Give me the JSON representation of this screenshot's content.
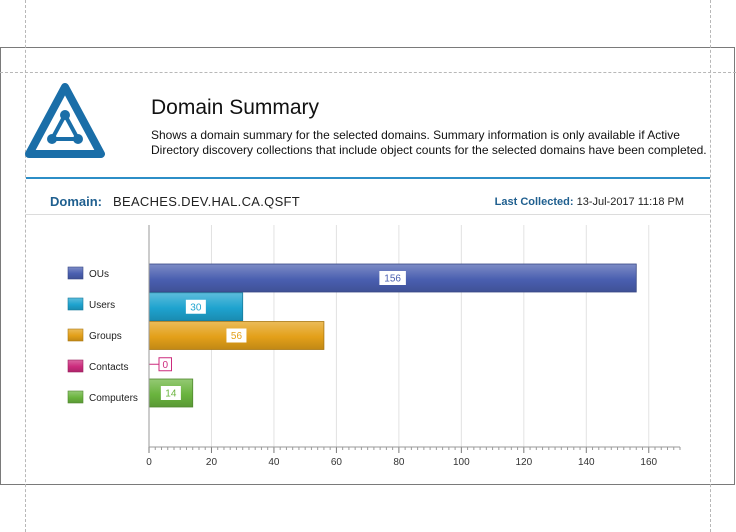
{
  "header": {
    "title": "Domain Summary",
    "description": "Shows a domain summary for the selected domains. Summary information is only available if Active Directory discovery collections that include object counts for the selected domains have been completed."
  },
  "domain": {
    "label": "Domain:",
    "value": "BEACHES.DEV.HAL.CA.QSFT",
    "last_collected_label": "Last Collected:",
    "last_collected_value": "13-Jul-2017 11:18 PM"
  },
  "colors": {
    "accent": "#2c8ec7",
    "logo": "#1a6ea8"
  },
  "chart_data": {
    "type": "bar",
    "orientation": "horizontal",
    "categories": [
      "OUs",
      "Users",
      "Groups",
      "Contacts",
      "Computers"
    ],
    "values": [
      156,
      30,
      56,
      0,
      14
    ],
    "colors": [
      "#4a5fb0",
      "#1ea3cf",
      "#e3a019",
      "#cc2b7d",
      "#6ab43e"
    ],
    "xlim": [
      0,
      170
    ],
    "xticks": [
      0,
      20,
      40,
      60,
      80,
      100,
      120,
      140,
      160
    ],
    "grid": true,
    "legend": "left"
  }
}
